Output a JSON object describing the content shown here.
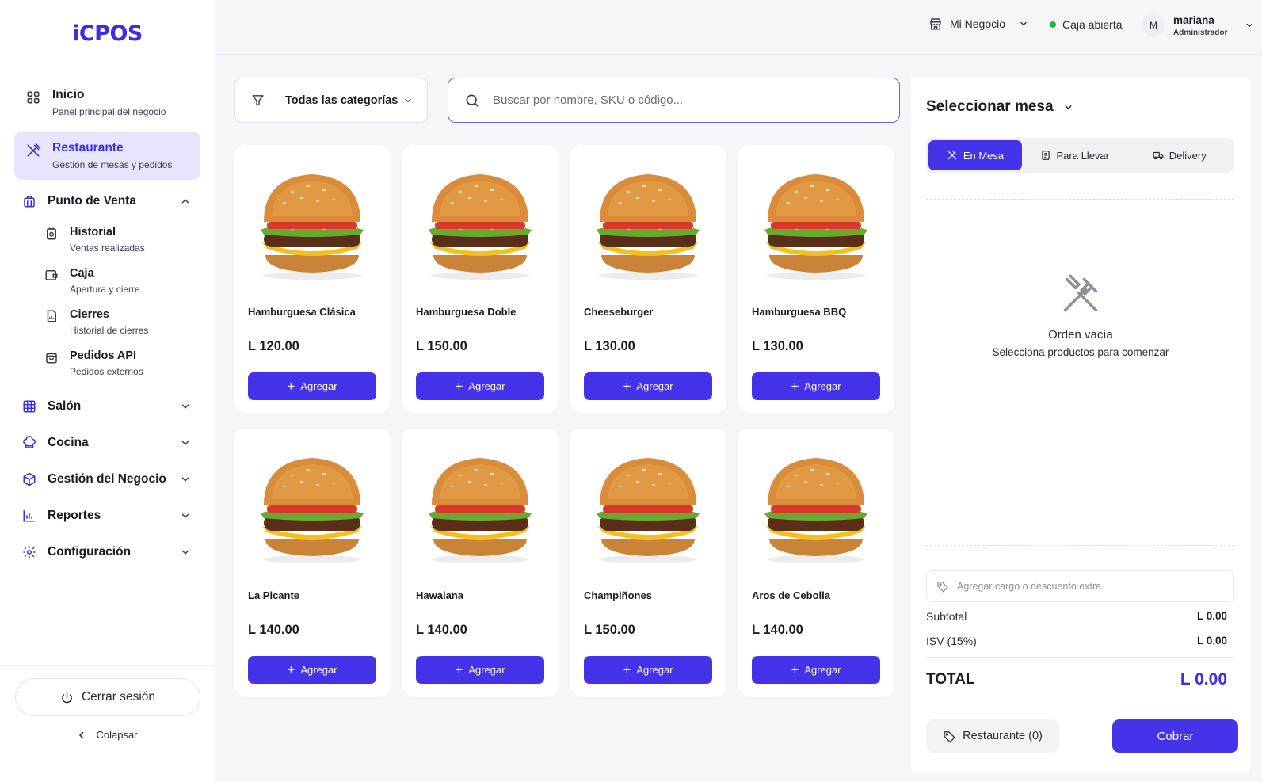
{
  "app": {
    "logo": "iCPOS"
  },
  "sidebar": {
    "inicio": {
      "title": "Inicio",
      "subtitle": "Panel principal del negocio"
    },
    "restaurante": {
      "title": "Restaurante",
      "subtitle": "Gestión de mesas y pedidos"
    },
    "punto_de_venta": {
      "title": "Punto de Venta",
      "items": [
        {
          "title": "Historial",
          "subtitle": "Ventas realizadas"
        },
        {
          "title": "Caja",
          "subtitle": "Apertura y cierre"
        },
        {
          "title": "Cierres",
          "subtitle": "Historial de cierres"
        },
        {
          "title": "Pedidos API",
          "subtitle": "Pedidos externos"
        }
      ]
    },
    "groups": [
      {
        "title": "Salón"
      },
      {
        "title": "Cocina"
      },
      {
        "title": "Gestión del Negocio"
      },
      {
        "title": "Reportes"
      },
      {
        "title": "Configuración"
      }
    ],
    "logout_label": "Cerrar sesión",
    "collapse_label": "Colapsar"
  },
  "topbar": {
    "business": "Mi Negocio",
    "register_status": "Caja abierta",
    "status_color": "#22b14c",
    "user": {
      "initial": "M",
      "name": "mariana",
      "role": "Administrador"
    }
  },
  "filters": {
    "category_selected": "Todas las categorías",
    "search_placeholder": "Buscar por nombre, SKU o código..."
  },
  "products": [
    {
      "name": "Hamburguesa Clásica",
      "price": "L 120.00",
      "button": "Agregar"
    },
    {
      "name": "Hamburguesa Doble",
      "price": "L 150.00",
      "button": "Agregar"
    },
    {
      "name": "Cheeseburger",
      "price": "L 130.00",
      "button": "Agregar"
    },
    {
      "name": "Hamburguesa BBQ",
      "price": "L 130.00",
      "button": "Agregar"
    },
    {
      "name": "La Picante",
      "price": "L 140.00",
      "button": "Agregar"
    },
    {
      "name": "Hawaiana",
      "price": "L 140.00",
      "button": "Agregar"
    },
    {
      "name": "Champiñones",
      "price": "L 150.00",
      "button": "Agregar"
    },
    {
      "name": "Aros de Cebolla",
      "price": "L 140.00",
      "button": "Agregar"
    }
  ],
  "order": {
    "table_select": "Seleccionar mesa",
    "tabs": [
      "En Mesa",
      "Para Llevar",
      "Delivery"
    ],
    "empty_title": "Orden vacía",
    "empty_subtitle": "Selecciona productos para comenzar",
    "extra_placeholder": "Agregar cargo o descuento extra",
    "subtotal_label": "Subtotal",
    "subtotal_value": "L 0.00",
    "tax_label": "ISV (15%)",
    "tax_value": "L 0.00",
    "total_label": "TOTAL",
    "total_value": "L 0.00",
    "restaurant_button": "Restaurante (0)",
    "charge_button": "Cobrar"
  },
  "colors": {
    "accent": "#4433e8",
    "accent_light": "#e6e5fd"
  }
}
